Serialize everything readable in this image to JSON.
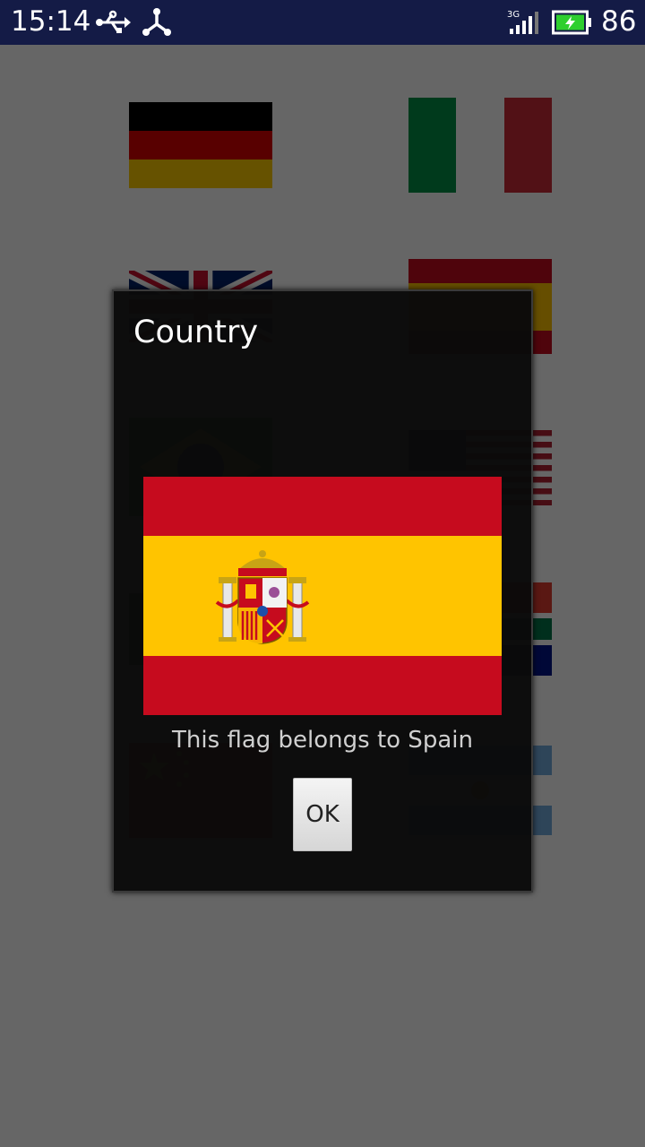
{
  "status_bar": {
    "time": "15:14",
    "battery_level": "86",
    "network_type": "3G",
    "icons": [
      "usb-icon",
      "share-icon",
      "signal-icon",
      "battery-charging-icon"
    ]
  },
  "background_flags": [
    {
      "country": "germany",
      "icon": "germany-flag"
    },
    {
      "country": "italy",
      "icon": "italy-flag"
    },
    {
      "country": "united-kingdom",
      "icon": "uk-flag"
    },
    {
      "country": "spain",
      "icon": "spain-flag"
    },
    {
      "country": "brazil",
      "icon": "brazil-flag"
    },
    {
      "country": "united-states",
      "icon": "us-flag"
    },
    {
      "country": "portugal",
      "icon": "portugal-flag"
    },
    {
      "country": "south-africa",
      "icon": "south-africa-flag"
    },
    {
      "country": "china",
      "icon": "china-flag"
    },
    {
      "country": "argentina",
      "icon": "argentina-flag"
    }
  ],
  "dialog": {
    "title": "Country",
    "flag_icon": "spain-flag",
    "message": "This flag belongs to Spain",
    "ok_label": "OK"
  },
  "colors": {
    "status_bar_bg": "#141b46",
    "dialog_bg": "#0a0a0a",
    "spain_red": "#c60b1e",
    "spain_yellow": "#ffc400"
  }
}
